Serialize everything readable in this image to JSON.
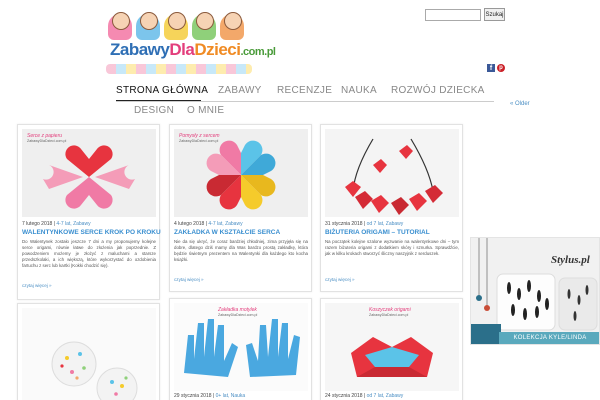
{
  "logo": {
    "w1": "Zabawy",
    "w2": "Dla",
    "w3": "Dzieci",
    "w4": ".com.pl"
  },
  "search": {
    "placeholder": "",
    "button": "Szukaj"
  },
  "social": {
    "fb": "f",
    "pin": "p"
  },
  "nav": {
    "row1": [
      "Strona Główna",
      "Zabawy",
      "Recenzje",
      "Nauka",
      "Rozwój dziecka"
    ],
    "row2": [
      "Design",
      "O mnie"
    ],
    "older": "« Older"
  },
  "cards": [
    {
      "img_label": "Serce z papieru",
      "img_sub": "ZabawyDlaDzieci.com.pl",
      "date": "7 lutego 2018",
      "sep": " | ",
      "cats": "4-7 lat, Zabawy",
      "title": "WALENTYNKOWE SERCE KROK PO KROKU",
      "excerpt": "Do Walentynek zostało jeszcze 7 dni a my proponujemy kolejne serce origami, równie łatwe do złożenia jak poprzednie. Z powodzeniem możemy je złożyć z maluchami a starsze przedszkolaki, a ich większą, które wykorzystać do ozdobienia fartuchu z serc lub kartki (Kokki chodzić się).",
      "more": "czytaj więcej »"
    },
    {
      "img_label": "Pomysły z sercem",
      "img_sub": "ZabawyDlaDzieci.com.pl",
      "date": "4 lutego 2018",
      "sep": " | ",
      "cats": "4-7 lat, Zabawy",
      "title": "ZAKŁADKA W KSZTAŁCIE SERCA",
      "excerpt": "Nie da się ukryć, że coraz bardziej chłodniej, zima przyjęła się na dobre, dlatego dziś mamy dla Was bardzo prostą zakładkę, która będzie świetnym prezentem na Walentynki dla każdego kto kocha książki.",
      "more": "czytaj więcej »"
    },
    {
      "img_label": "",
      "img_sub": "",
      "date": "31 stycznia 2018",
      "sep": " | ",
      "cats": "od 7 lat, Zabawy",
      "title": "BIŻUTERIA ORIGAMI – TUTORIAL",
      "excerpt": "Na początek kolejne szalone wyzwanie na walentynkowe dni – tym razem biżuteria origami z dodatkiem skóry i sznurka. Sprawdźcie, jak w kilku krokach stworzyć śliczny naszyjnik z serduszek.",
      "more": "czytaj więcej »"
    },
    {
      "img_label": "",
      "img_sub": "",
      "date": "",
      "sep": "",
      "cats": "",
      "title": "",
      "excerpt": "",
      "more": ""
    },
    {
      "img_label": "Zakładka motylek",
      "img_sub": "ZabawyDlaDzieci.com.pl",
      "date": "29 stycznia 2018",
      "sep": " | ",
      "cats": "0+ lat, Nauka",
      "title": "",
      "excerpt": "",
      "more": ""
    },
    {
      "img_label": "Koszyczek origami",
      "img_sub": "ZabawyDlaDzieci.com.pl",
      "date": "24 stycznia 2018",
      "sep": " | ",
      "cats": "od 7 lat, Zabawy",
      "title": "",
      "excerpt": "",
      "more": ""
    }
  ],
  "ad": {
    "brand": "Stylus.pl",
    "banner": "KOLEKCJA KYLE/LINDA"
  },
  "colors": {
    "accent": "#3a8fd0",
    "heart_red": "#e7343f",
    "heart_pink": "#f07aa5",
    "heart_blue": "#5bc3e8",
    "heart_yellow": "#f5cb2b"
  }
}
